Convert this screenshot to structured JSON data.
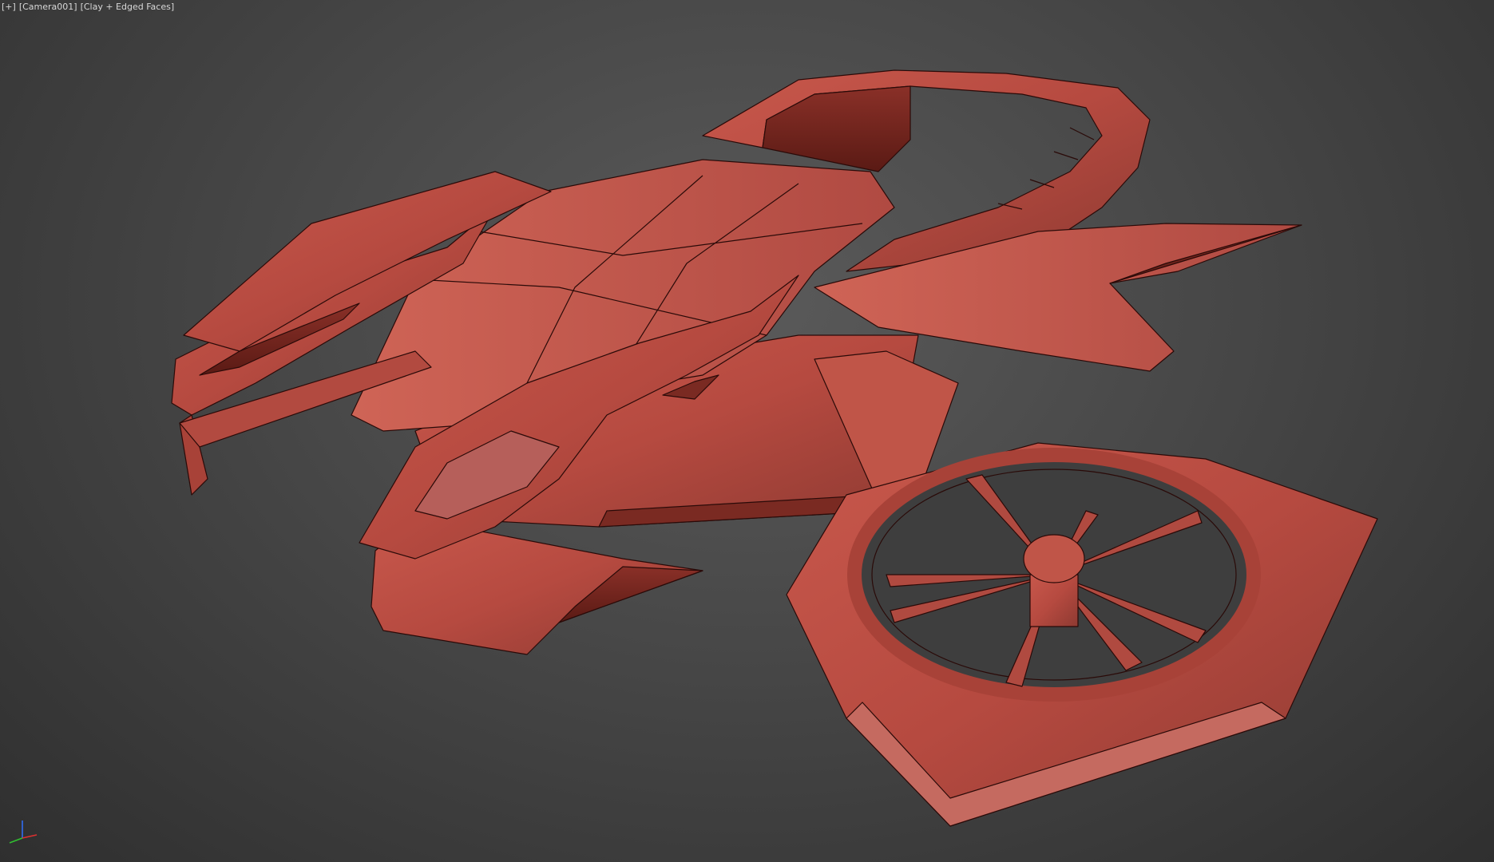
{
  "viewport": {
    "label_plus": "[+]",
    "label_camera": "[Camera001]",
    "label_shading": "[Clay + Edged Faces]"
  },
  "scene": {
    "object": "hover-vehicle",
    "material_color": "#b84a40",
    "edge_color": "#2a0a08",
    "background_top": "#5a5a5a",
    "background_bottom": "#2f2f2f"
  },
  "gizmo": {
    "x_color": "#e03030",
    "y_color": "#30c030",
    "z_color": "#3070ff",
    "icon": "axis-gizmo-icon"
  }
}
